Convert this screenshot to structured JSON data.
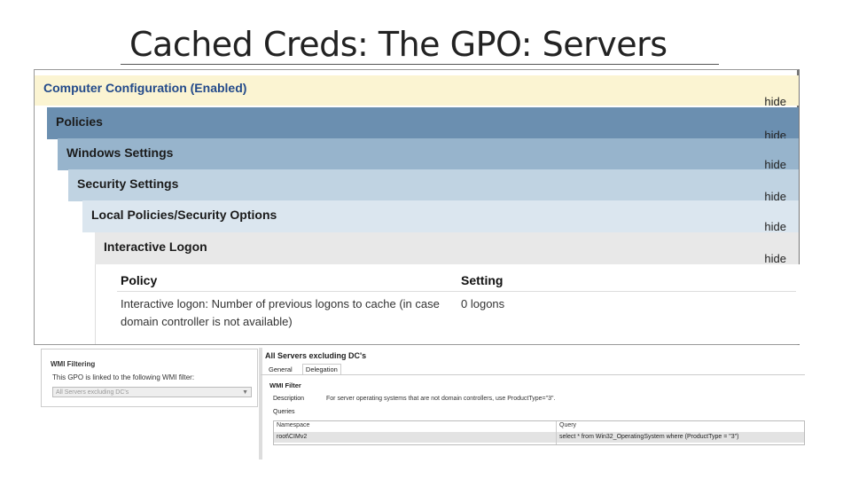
{
  "slide": {
    "title": "Cached Creds: The GPO: Servers"
  },
  "gpo": {
    "hide_label": "hide",
    "levels": [
      {
        "label": "Computer Configuration (Enabled)"
      },
      {
        "label": "Policies"
      },
      {
        "label": "Windows Settings"
      },
      {
        "label": "Security Settings"
      },
      {
        "label": "Local Policies/Security Options"
      },
      {
        "label": "Interactive Logon"
      }
    ],
    "table": {
      "headers": {
        "policy": "Policy",
        "setting": "Setting"
      },
      "rows": [
        {
          "policy": "Interactive logon: Number of previous logons to cache (in case domain controller is not available)",
          "setting": "0 logons"
        }
      ]
    }
  },
  "wmi_filtering": {
    "heading": "WMI Filtering",
    "text": "This GPO is linked to the following WMI filter:",
    "selected": "All Servers excluding DC's"
  },
  "wmi_filter": {
    "title": "All Servers excluding DC's",
    "tabs": [
      "General",
      "Delegation"
    ],
    "heading": "WMI Filter",
    "description_label": "Description",
    "description": "For server operating systems that are not domain controllers, use ProductType=\"3\".",
    "queries_label": "Queries",
    "columns": {
      "namespace": "Namespace",
      "query": "Query"
    },
    "rows": [
      {
        "namespace": "root\\CIMv2",
        "query": "select * from Win32_OperatingSystem where (ProductType = \"3\")"
      }
    ]
  }
}
